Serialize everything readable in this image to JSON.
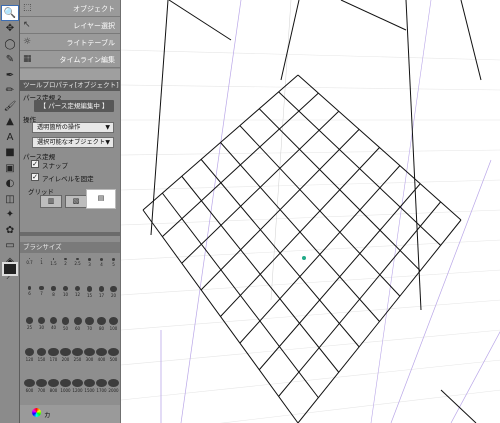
{
  "toolbar": {
    "tools": [
      {
        "name": "zoom-tool",
        "glyph": "🔍"
      },
      {
        "name": "move-tool",
        "glyph": "✥"
      },
      {
        "name": "select-tool",
        "glyph": "◯"
      },
      {
        "name": "eyedropper-tool",
        "glyph": "✎"
      },
      {
        "name": "pen-tool",
        "glyph": "✒"
      },
      {
        "name": "pencil-tool",
        "glyph": "✏"
      },
      {
        "name": "brush-tool",
        "glyph": "🖌"
      },
      {
        "name": "ruler-tool",
        "glyph": "▲"
      },
      {
        "name": "text-tool",
        "glyph": "A"
      },
      {
        "name": "fill-tool",
        "glyph": "■"
      },
      {
        "name": "gradient-tool",
        "glyph": "▣"
      },
      {
        "name": "blend-tool",
        "glyph": "◐"
      },
      {
        "name": "eraser-tool",
        "glyph": "◫"
      },
      {
        "name": "airbrush-tool",
        "glyph": "✦"
      },
      {
        "name": "decoration-tool",
        "glyph": "✿"
      },
      {
        "name": "frame-tool",
        "glyph": "▭"
      },
      {
        "name": "balloon-tool",
        "glyph": "◈"
      },
      {
        "name": "line-tool",
        "glyph": "⟋"
      },
      {
        "name": "color-swatch",
        "glyph": "■"
      }
    ]
  },
  "subtool_panel": {
    "items": [
      {
        "label": "オブジェクト",
        "icon": "⬚"
      },
      {
        "label": "レイヤー選択",
        "icon": "↖"
      },
      {
        "label": "ライトテーブル",
        "icon": "☼"
      },
      {
        "label": "タイムライン編集",
        "icon": "▦"
      }
    ]
  },
  "tool_property": {
    "title": "ツールプロパティ[オブジェクト]",
    "subtitle": "パース定規 2",
    "mode": "【 パース定規編集中 】",
    "operation_label": "操作",
    "operation_value": "透明箇所の操作",
    "select_value": "選択可能なオブジェクト",
    "perspective_label": "パース定規",
    "snap_label": "スナップ",
    "eyelevel_label": "アイレベルを固定",
    "grid_label": "グリッド",
    "snap_checked": "✓",
    "eyelevel_checked": "✓"
  },
  "brush_size": {
    "title": "ブラシサイズ",
    "sizes": [
      "0.7",
      "1",
      "1.5",
      "2",
      "2.5",
      "3",
      "4",
      "5",
      "6",
      "7",
      "8",
      "10",
      "12",
      "15",
      "17",
      "20",
      "25",
      "30",
      "40",
      "50",
      "60",
      "70",
      "80",
      "100",
      "120",
      "150",
      "170",
      "200",
      "250",
      "300",
      "400",
      "500",
      "600",
      "700",
      "800",
      "1000",
      "1200",
      "1500",
      "1700",
      "2000"
    ]
  },
  "bottom_panel": {
    "tab_label": "カ"
  },
  "colors": {
    "panel_bg": "#8e8e8e",
    "toolbar_bg": "#8b8b8b",
    "grid_line": "#111111",
    "guide_line": "#b9a6e8",
    "accent": "#3d6eb3"
  }
}
